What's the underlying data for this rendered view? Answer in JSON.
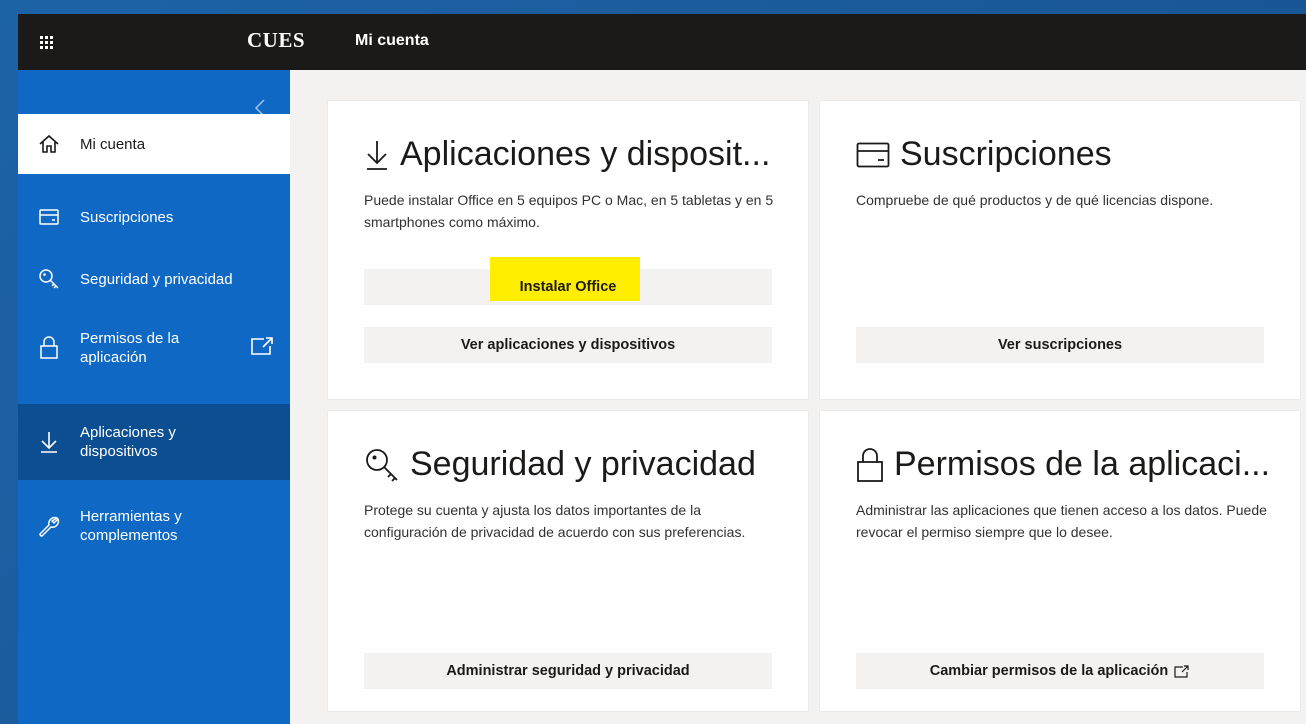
{
  "header": {
    "brand": "CUES",
    "title": "Mi cuenta"
  },
  "sidebar": {
    "collapse_icon": "chevron-left",
    "items": [
      {
        "label": "Mi cuenta",
        "icon": "home-icon",
        "state": "active"
      },
      {
        "label": "Suscripciones",
        "icon": "card-icon"
      },
      {
        "label": "Seguridad y privacidad",
        "icon": "key-icon"
      },
      {
        "label_line1": "Permisos de la",
        "label_line2": "aplicación",
        "icon": "lock-icon",
        "external": true
      },
      {
        "label_line1": "Aplicaciones y",
        "label_line2": "dispositivos",
        "icon": "download-icon",
        "state": "selected"
      },
      {
        "label_line1": "Herramientas y",
        "label_line2": "complementos",
        "icon": "wrench-icon"
      }
    ]
  },
  "cards": {
    "apps": {
      "title": "Aplicaciones y disposit...",
      "description": "Puede instalar Office en 5 equipos PC o Mac, en 5 tabletas y en 5 smartphones como máximo.",
      "install_button": "Instalar Office",
      "view_button": "Ver aplicaciones y dispositivos"
    },
    "subscriptions": {
      "title": "Suscripciones",
      "description": "Compruebe de qué productos y de qué licencias dispone.",
      "button": "Ver suscripciones"
    },
    "security": {
      "title": "Seguridad y privacidad",
      "description": "Protege su cuenta y ajusta los datos importantes de la configuración de privacidad de acuerdo con sus preferencias.",
      "button": "Administrar seguridad y privacidad"
    },
    "permissions": {
      "title": "Permisos de la aplicaci...",
      "description": "Administrar las aplicaciones que tienen acceso a los datos. Puede revocar el permiso siempre que lo desee.",
      "button": "Cambiar permisos de la aplicación"
    }
  },
  "colors": {
    "sidebar": "#0f69c4",
    "sidebar_selected": "#0b4e91",
    "topbar": "#1b1a19",
    "highlight": "#ffee00"
  }
}
